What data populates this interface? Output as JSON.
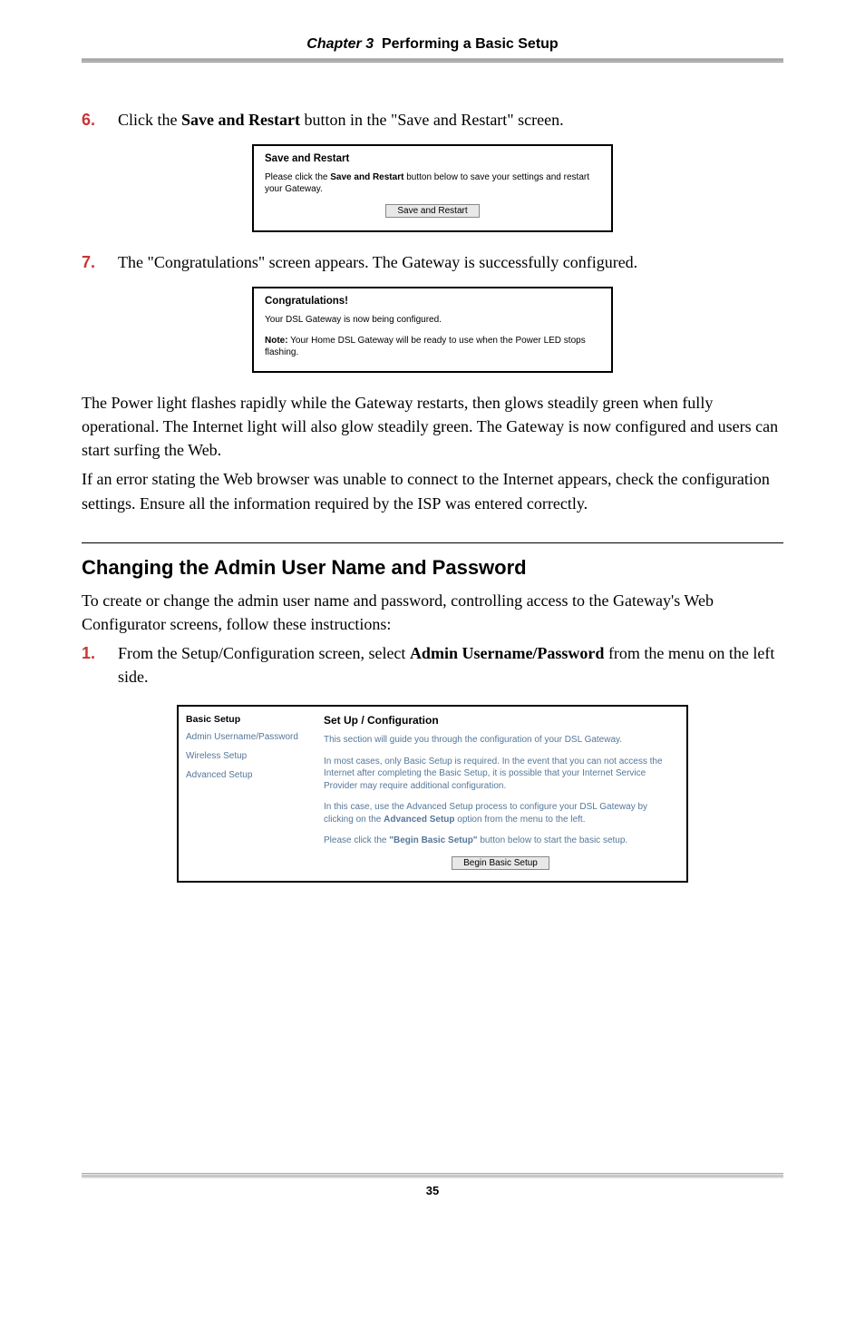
{
  "header": {
    "chapter": "Chapter 3",
    "title": "Performing a Basic Setup"
  },
  "step6": {
    "num": "6.",
    "text_a": "Click the ",
    "text_bold": "Save and Restart",
    "text_b": " button in the \"Save and Restart\" screen."
  },
  "shot1": {
    "title": "Save and Restart",
    "body_a": "Please click the ",
    "body_bold": "Save and Restart",
    "body_b": " button below to save your settings and restart your Gateway.",
    "button": "Save and Restart"
  },
  "step7": {
    "num": "7.",
    "text": "The \"Congratulations\" screen appears. The Gateway is successfully configured."
  },
  "shot2": {
    "title": "Congratulations!",
    "line1": "Your DSL Gateway is now being configured.",
    "note_label": "Note:",
    "note_body": " Your Home DSL Gateway will be ready to use when the Power LED stops flashing."
  },
  "para1": "The Power light flashes rapidly while the Gateway restarts, then glows steadily green when fully operational. The Internet light will also glow steadily green. The Gateway is now configured and users can start surfing the Web.",
  "para2_a": "If an error stating the Web browser was unable to connect to the Internet appears, check the configuration settings. Ensure all the information required by the ",
  "para2_isp": "ISP",
  "para2_b": " was entered correctly.",
  "section": {
    "heading": "Changing the Admin User Name and Password",
    "intro": "To create or change the admin user name and password, controlling access to the Gateway's Web Configurator screens, follow these instructions:"
  },
  "step1b": {
    "num": "1.",
    "a": "From the Setup/Configuration screen, select ",
    "bold": "Admin Username/Password",
    "b": " from the menu on the left side."
  },
  "config": {
    "left": {
      "top": "Basic Setup",
      "l1": "Admin Username/Password",
      "l2": "Wireless Setup",
      "l3": "Advanced Setup"
    },
    "right": {
      "title": "Set Up / Configuration",
      "p1": "This section will guide you through the configuration of your DSL Gateway.",
      "p2": "In most cases, only Basic Setup is required. In the event that you can not access the Internet after completing the Basic Setup, it is possible that your Internet Service Provider may require additional configuration.",
      "p3_a": "In this case, use the Advanced Setup process to configure your DSL Gateway by clicking on the ",
      "p3_bold": "Advanced Setup",
      "p3_b": " option from the menu to the left.",
      "p4_a": "Please click the ",
      "p4_bold": "\"Begin Basic Setup\"",
      "p4_b": " button below to start the basic setup.",
      "button": "Begin Basic Setup"
    }
  },
  "page_number": "35"
}
